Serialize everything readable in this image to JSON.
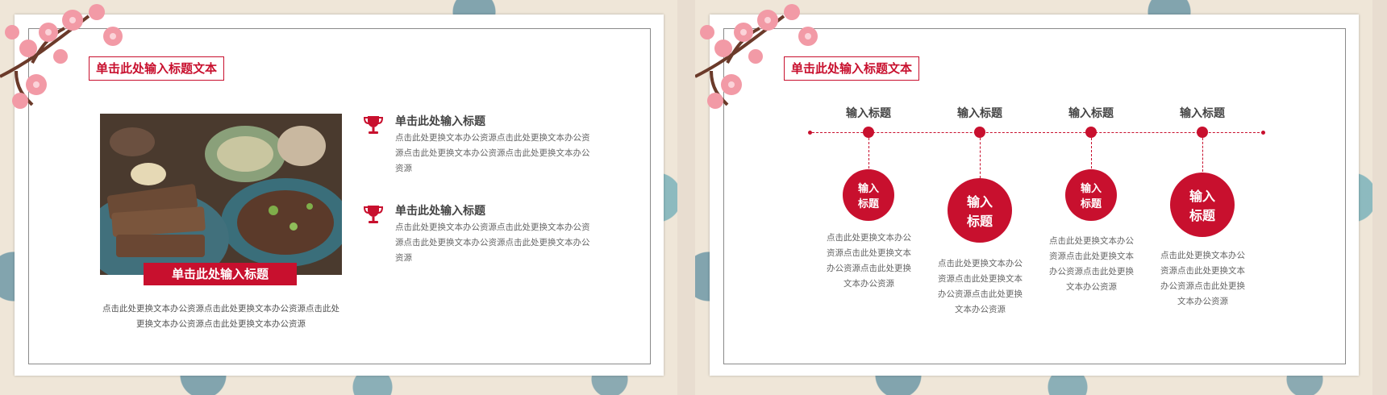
{
  "slide1": {
    "title": "单击此处输入标题文本",
    "photo_caption": "单击此处输入标题",
    "photo_desc": "点击此处更换文本办公资源点击此处更换文本办公资源点击此处更换文本办公资源点击此处更换文本办公资源",
    "items": [
      {
        "title": "单击此处输入标题",
        "desc": "点击此处更换文本办公资源点击此处更换文本办公资源点击此处更换文本办公资源点击此处更换文本办公资源",
        "icon": "trophy-icon"
      },
      {
        "title": "单击此处输入标题",
        "desc": "点击此处更换文本办公资源点击此处更换文本办公资源点击此处更换文本办公资源点击此处更换文本办公资源",
        "icon": "trophy-icon"
      }
    ]
  },
  "slide2": {
    "title": "单击此处输入标题文本",
    "timeline": [
      {
        "label": "输入标题",
        "circle_line1": "输入",
        "circle_line2": "标题",
        "desc": "点击此处更换文本办公资源点击此处更换文本办公资源点击此处更换文本办公资源"
      },
      {
        "label": "输入标题",
        "circle_line1": "输入",
        "circle_line2": "标题",
        "desc": "点击此处更换文本办公资源点击此处更换文本办公资源点击此处更换文本办公资源"
      },
      {
        "label": "输入标题",
        "circle_line1": "输入",
        "circle_line2": "标题",
        "desc": "点击此处更换文本办公资源点击此处更换文本办公资源点击此处更换文本办公资源"
      },
      {
        "label": "输入标题",
        "circle_line1": "输入",
        "circle_line2": "标题",
        "desc": "点击此处更换文本办公资源点击此处更换文本办公资源点击此处更换文本办公资源"
      }
    ]
  },
  "colors": {
    "accent": "#c8102e",
    "background": "#efe6d8",
    "teal": "#3c8ca0"
  }
}
